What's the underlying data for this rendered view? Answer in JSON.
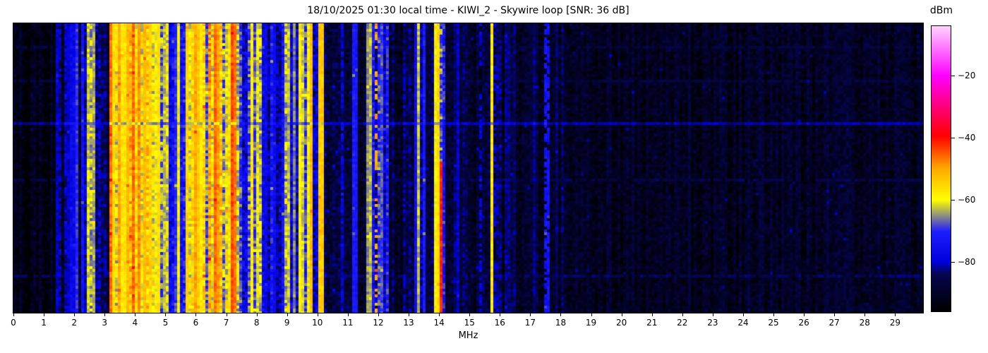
{
  "chart_data": {
    "type": "heatmap",
    "subtype": "radio-spectrum-waterfall",
    "title": "18/10/2025 01:30 local time - KIWI_2 - Skywire loop [SNR: 36 dB]",
    "xlabel": "MHz",
    "x_range": [
      0,
      29.92
    ],
    "x_ticks": [
      0,
      1,
      2,
      3,
      4,
      5,
      6,
      7,
      8,
      9,
      10,
      11,
      12,
      13,
      14,
      15,
      16,
      17,
      18,
      19,
      20,
      21,
      22,
      23,
      24,
      25,
      26,
      27,
      28,
      29
    ],
    "grid": false,
    "colorbar": {
      "label": "dBm",
      "ticks": [
        -20,
        -40,
        -60,
        -80
      ],
      "range_dbm": [
        -96,
        -4
      ],
      "position": "right"
    },
    "colormap_stops": [
      [
        0.0,
        "#000000"
      ],
      [
        0.13,
        "#050550"
      ],
      [
        0.174,
        "#0000dc"
      ],
      [
        0.28,
        "#1e1eff"
      ],
      [
        0.391,
        "#ffff00"
      ],
      [
        0.5,
        "#ffaa00"
      ],
      [
        0.614,
        "#ff0000"
      ],
      [
        0.75,
        "#ff00a0"
      ],
      [
        0.826,
        "#ff00ff"
      ],
      [
        1.0,
        "#ffd2ff"
      ]
    ],
    "bands_mhz_dbm_spread": [
      [
        0.0,
        1.42,
        -93,
        3
      ],
      [
        1.42,
        1.62,
        -85,
        6
      ],
      [
        1.62,
        2.12,
        -86,
        7
      ],
      [
        2.12,
        2.48,
        -80,
        8
      ],
      [
        2.48,
        2.82,
        -73,
        11
      ],
      [
        2.82,
        3.12,
        -84,
        7
      ],
      [
        3.12,
        4.12,
        -63,
        14
      ],
      [
        4.12,
        5.12,
        -68,
        14
      ],
      [
        5.12,
        5.62,
        -77,
        11
      ],
      [
        5.62,
        6.42,
        -60,
        12
      ],
      [
        6.42,
        7.38,
        -57,
        12
      ],
      [
        7.38,
        7.68,
        -72,
        12
      ],
      [
        7.68,
        8.18,
        -69,
        12
      ],
      [
        8.18,
        8.88,
        -80,
        8
      ],
      [
        8.88,
        9.92,
        -70,
        13
      ],
      [
        9.92,
        10.62,
        -82,
        8
      ],
      [
        10.62,
        11.58,
        -86,
        6
      ],
      [
        11.58,
        12.32,
        -77,
        10
      ],
      [
        12.32,
        13.12,
        -87,
        5
      ],
      [
        13.12,
        13.58,
        -80,
        9
      ],
      [
        13.58,
        13.82,
        -88,
        4
      ],
      [
        13.82,
        14.22,
        -77,
        11
      ],
      [
        14.22,
        15.32,
        -88,
        4
      ],
      [
        15.32,
        16.02,
        -85,
        6
      ],
      [
        16.02,
        18.12,
        -89,
        4
      ],
      [
        18.12,
        29.92,
        -91,
        3
      ]
    ],
    "carriers": [
      {
        "f": 1.45,
        "db": -80
      },
      {
        "f": 1.78,
        "db": -80
      },
      {
        "f": 1.95,
        "db": -77
      },
      {
        "f": 2.05,
        "db": -70
      },
      {
        "f": 2.3,
        "db": -74
      },
      {
        "f": 2.5,
        "db": -62
      },
      {
        "f": 2.62,
        "db": -64
      },
      {
        "f": 3.2,
        "db": -46
      },
      {
        "f": 3.32,
        "db": -56
      },
      {
        "f": 3.45,
        "db": -50
      },
      {
        "f": 3.62,
        "db": -57
      },
      {
        "f": 3.75,
        "db": -52
      },
      {
        "f": 3.95,
        "db": -46
      },
      {
        "f": 4.15,
        "db": -48
      },
      {
        "f": 4.3,
        "db": -52
      },
      {
        "f": 4.5,
        "db": -55
      },
      {
        "f": 4.65,
        "db": -60
      },
      {
        "f": 4.8,
        "db": -56
      },
      {
        "f": 5.0,
        "db": -63
      },
      {
        "f": 5.3,
        "db": -70
      },
      {
        "f": 5.45,
        "db": -60
      },
      {
        "f": 5.75,
        "db": -55
      },
      {
        "f": 5.95,
        "db": -50
      },
      {
        "f": 6.07,
        "db": -54
      },
      {
        "f": 6.17,
        "db": -58
      },
      {
        "f": 6.6,
        "db": -46
      },
      {
        "f": 6.75,
        "db": -49
      },
      {
        "f": 7.2,
        "db": -44
      },
      {
        "f": 7.3,
        "db": -47
      },
      {
        "f": 7.85,
        "db": -58
      },
      {
        "f": 8.0,
        "db": -61
      },
      {
        "f": 8.35,
        "db": -77
      },
      {
        "f": 8.6,
        "db": -76
      },
      {
        "f": 9.05,
        "db": -63
      },
      {
        "f": 9.25,
        "db": -66
      },
      {
        "f": 9.4,
        "db": -59
      },
      {
        "f": 9.55,
        "db": -62
      },
      {
        "f": 9.7,
        "db": -60
      },
      {
        "f": 9.82,
        "db": -52
      },
      {
        "f": 10.12,
        "db": -54
      },
      {
        "f": 10.4,
        "db": -43,
        "hw": 0.045
      },
      {
        "f": 11.15,
        "db": -72
      },
      {
        "f": 11.3,
        "db": -73
      },
      {
        "f": 11.65,
        "db": -65
      },
      {
        "f": 11.78,
        "db": -63
      },
      {
        "f": 11.9,
        "db": -50,
        "dash": 0.4
      },
      {
        "f": 12.1,
        "db": -68
      },
      {
        "f": 13.2,
        "db": -75
      },
      {
        "f": 13.35,
        "db": -63
      },
      {
        "f": 13.5,
        "db": -72
      },
      {
        "f": 13.85,
        "db": -59
      },
      {
        "f": 14.0,
        "db": -56
      },
      {
        "f": 14.06,
        "db": -41,
        "hw": 0.04,
        "y0": 0.47
      },
      {
        "f": 14.6,
        "db": -80
      },
      {
        "f": 15.39,
        "db": -79,
        "dash": 0.6
      },
      {
        "f": 15.7,
        "db": -58,
        "hw": 0.04
      },
      {
        "f": 15.82,
        "db": -80,
        "dash": 0.5
      },
      {
        "f": 16.25,
        "db": -83
      },
      {
        "f": 16.45,
        "db": -84
      },
      {
        "f": 17.1,
        "db": -83
      },
      {
        "f": 17.55,
        "db": -74,
        "dash": 0.8
      },
      {
        "f": 17.85,
        "db": -84
      },
      {
        "f": 22.2,
        "db": -87
      }
    ],
    "noise_row_streaks": [
      {
        "y": 0.08,
        "db": -86,
        "all": false
      },
      {
        "y": 0.19,
        "db": -86,
        "all": false
      },
      {
        "y": 0.335,
        "db": -72,
        "all": true
      },
      {
        "y": 0.53,
        "db": -85,
        "all": false
      },
      {
        "y": 0.86,
        "db": -84,
        "all": false
      }
    ]
  }
}
